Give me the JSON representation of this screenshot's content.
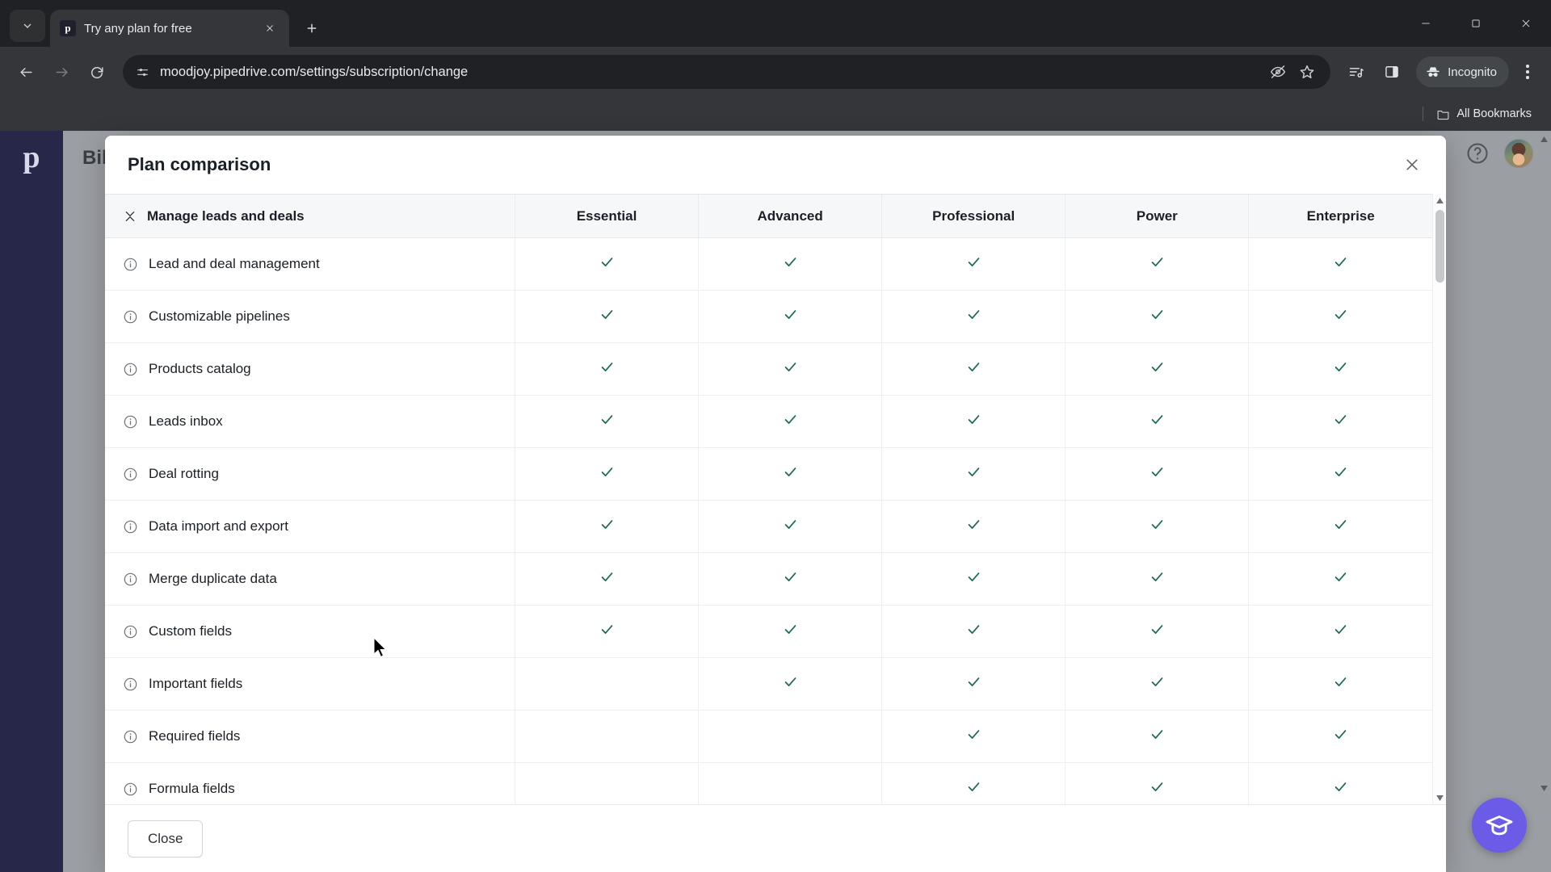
{
  "browser": {
    "tab": {
      "title": "Try any plan for free",
      "favicon_letter": "p",
      "favicon_name": "pipedrive-favicon"
    },
    "tab_search_name": "tab-search-icon",
    "new_tab_name": "new-tab-icon",
    "window_controls": [
      "minimize",
      "maximize",
      "close"
    ],
    "nav": {
      "back": "back-arrow-icon",
      "forward": "forward-arrow-icon",
      "reload": "reload-icon"
    },
    "omnibox": {
      "url": "moodjoy.pipedrive.com/settings/subscription/change",
      "placeholder": "Search Google or type a URL",
      "lead_icon": "site-settings-icon",
      "right_icons": [
        "tracking-protection-off-icon",
        "bookmark-star-icon"
      ]
    },
    "toolbar_icons": [
      "reading-list-icon",
      "side-panel-icon"
    ],
    "incognito_label": "Incognito",
    "menu_name": "chrome-menu-icon",
    "bookmarks_bar": {
      "label": "All Bookmarks",
      "icon": "folder-icon"
    }
  },
  "app": {
    "logo_letter": "p",
    "page_title": "Bill",
    "help_icon": "help-question-icon",
    "avatar_name": "user-avatar",
    "academy_button": {
      "icon": "graduation-cap-icon",
      "color": "#6b5ce7"
    }
  },
  "modal": {
    "title": "Plan comparison",
    "close_icon": "close-x-icon",
    "footer_button": "Close",
    "scrollbar": {
      "up_icon": "scroll-up-arrow",
      "down_icon": "scroll-down-arrow"
    }
  },
  "table": {
    "group_header": {
      "label": "Manage leads and deals",
      "collapse_icon": "collapse-group-icon"
    },
    "plans": [
      "Essential",
      "Advanced",
      "Professional",
      "Power",
      "Enterprise"
    ],
    "check_color": "#1c6b4d",
    "info_icon": "info-circle-icon",
    "check_icon": "check-icon",
    "rows": [
      {
        "feature": "Lead and deal management",
        "availability": [
          true,
          true,
          true,
          true,
          true
        ]
      },
      {
        "feature": "Customizable pipelines",
        "availability": [
          true,
          true,
          true,
          true,
          true
        ]
      },
      {
        "feature": "Products catalog",
        "availability": [
          true,
          true,
          true,
          true,
          true
        ]
      },
      {
        "feature": "Leads inbox",
        "availability": [
          true,
          true,
          true,
          true,
          true
        ]
      },
      {
        "feature": "Deal rotting",
        "availability": [
          true,
          true,
          true,
          true,
          true
        ]
      },
      {
        "feature": "Data import and export",
        "availability": [
          true,
          true,
          true,
          true,
          true
        ]
      },
      {
        "feature": "Merge duplicate data",
        "availability": [
          true,
          true,
          true,
          true,
          true
        ]
      },
      {
        "feature": "Custom fields",
        "availability": [
          true,
          true,
          true,
          true,
          true
        ]
      },
      {
        "feature": "Important fields",
        "availability": [
          false,
          true,
          true,
          true,
          true
        ]
      },
      {
        "feature": "Required fields",
        "availability": [
          false,
          false,
          true,
          true,
          true
        ]
      },
      {
        "feature": "Formula fields",
        "availability": [
          false,
          false,
          true,
          true,
          true
        ]
      }
    ]
  }
}
